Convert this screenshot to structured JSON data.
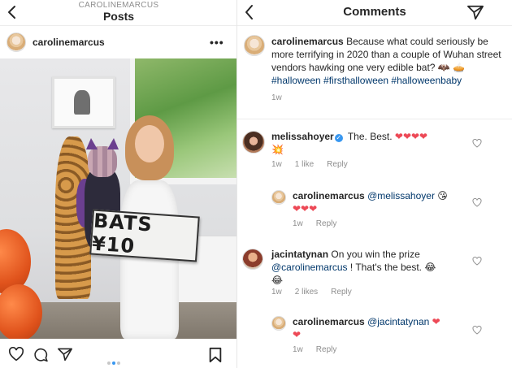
{
  "left": {
    "header": {
      "username_caps": "CAROLINEMARCUS",
      "title": "Posts"
    },
    "post_user": "carolinemarcus",
    "more_label": "•••",
    "sign_text": "BATS ¥10",
    "carousel": {
      "count": 3,
      "active": 2
    }
  },
  "right": {
    "header": {
      "title": "Comments"
    },
    "caption": {
      "user": "carolinemarcus",
      "text": "Because what could seriously be more terrifying in 2020 than a couple of Wuhan street vendors hawking one very edible bat? 🦇 🥧",
      "hashtags": "#halloween #firsthalloween #halloweenbaby",
      "time": "1w"
    },
    "comments": [
      {
        "user": "melissahoyer",
        "verified": true,
        "text": "The. Best.",
        "hearts": "❤❤❤❤",
        "extra": "💥",
        "time": "1w",
        "likes": "1 like",
        "reply": "Reply"
      },
      {
        "user": "carolinemarcus",
        "mention": "@melissahoyer",
        "emoji": "😘",
        "hearts": "❤❤❤",
        "time": "1w",
        "reply": "Reply"
      },
      {
        "user": "jacintatynan",
        "text": "On you win the prize",
        "mention": "@carolinemarcus",
        "text2": "! That's the best.",
        "emoji": "😂",
        "emoji2": "😂",
        "time": "1w",
        "likes": "2 likes",
        "reply": "Reply"
      },
      {
        "user": "carolinemarcus",
        "mention": "@jacintatynan",
        "hearts": "❤",
        "hearts2": "❤",
        "time": "1w",
        "reply": "Reply"
      }
    ]
  }
}
